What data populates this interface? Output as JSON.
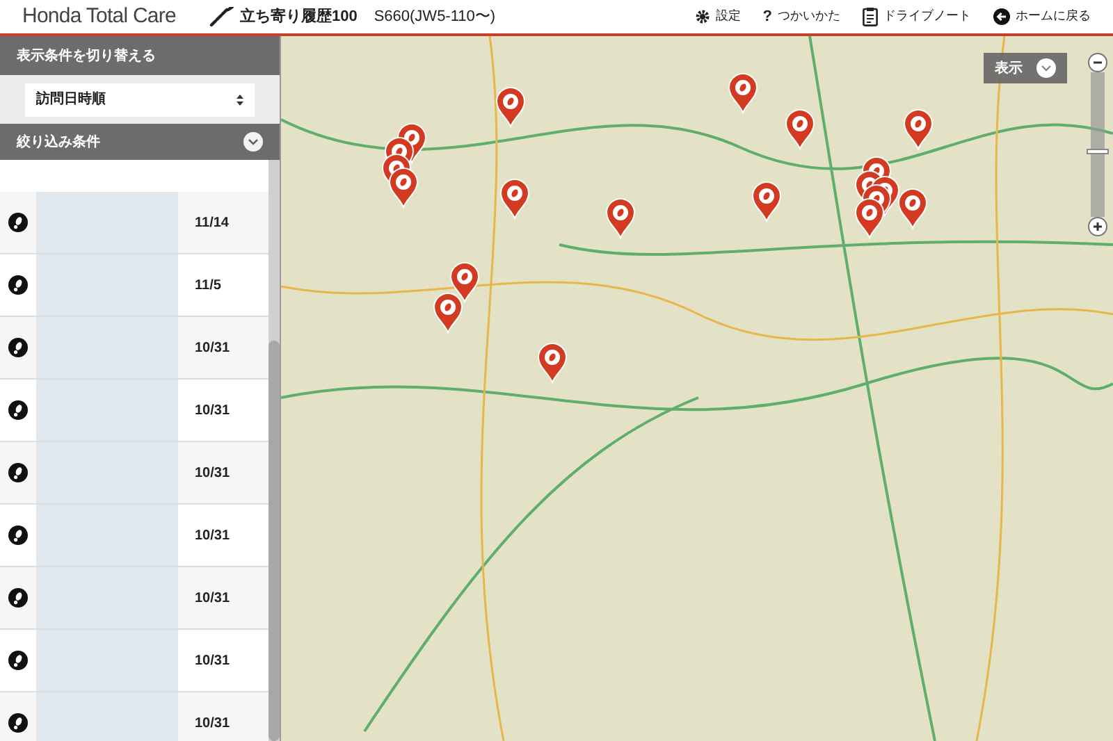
{
  "header": {
    "brand": "Honda Total Care",
    "page_title": "立ち寄り履歴100",
    "vehicle": "S660(JW5-110〜)",
    "nav": [
      {
        "kind": "settings",
        "label": "設定"
      },
      {
        "kind": "help",
        "icon": "?",
        "label": "つかいかた"
      },
      {
        "kind": "notes",
        "label": "ドライブノート"
      },
      {
        "kind": "home",
        "label": "ホームに戻る"
      }
    ]
  },
  "sidebar": {
    "display_heading": "表示条件を切り替える",
    "sort_select": {
      "value": "訪問日時順"
    },
    "filter_heading": "絞り込み条件",
    "filter_expanded": false,
    "visits": [
      {
        "date": "11/14"
      },
      {
        "date": "11/5"
      },
      {
        "date": "10/31"
      },
      {
        "date": "10/31"
      },
      {
        "date": "10/31"
      },
      {
        "date": "10/31"
      },
      {
        "date": "10/31"
      },
      {
        "date": "10/31"
      },
      {
        "date": "10/31"
      }
    ]
  },
  "map": {
    "display_button": "表示",
    "zoom": {
      "level": 0.45
    }
  }
}
